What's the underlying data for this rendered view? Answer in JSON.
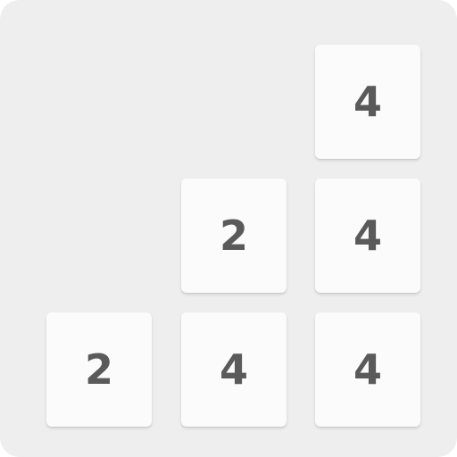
{
  "board": {
    "tiles": [
      {
        "row": 0,
        "col": 2,
        "value": "4"
      },
      {
        "row": 1,
        "col": 1,
        "value": "2"
      },
      {
        "row": 1,
        "col": 2,
        "value": "4"
      },
      {
        "row": 2,
        "col": 0,
        "value": "2"
      },
      {
        "row": 2,
        "col": 1,
        "value": "4"
      },
      {
        "row": 2,
        "col": 2,
        "value": "4"
      }
    ]
  }
}
